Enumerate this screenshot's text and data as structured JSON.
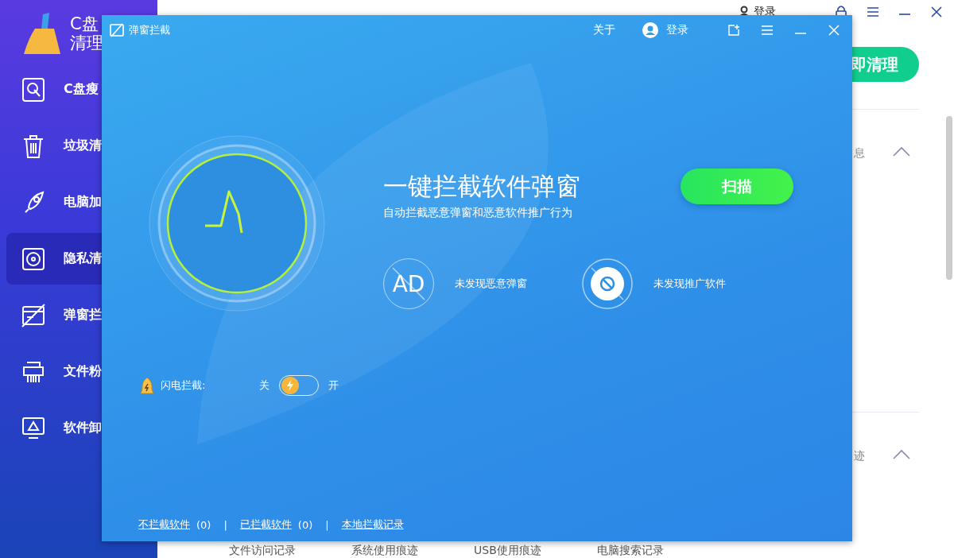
{
  "app": {
    "logo_lines": [
      "C盘",
      "清理"
    ],
    "sidebar": {
      "items": [
        {
          "kind": "disk",
          "label": "C盘瘦",
          "selected": false
        },
        {
          "kind": "trash",
          "label": "垃圾清",
          "selected": false
        },
        {
          "kind": "rocket",
          "label": "电脑加",
          "selected": false
        },
        {
          "kind": "privacy",
          "label": "隐私清",
          "selected": true
        },
        {
          "kind": "popup",
          "label": "弹窗拦",
          "selected": false
        },
        {
          "kind": "shredder",
          "label": "文件粉",
          "selected": false
        },
        {
          "kind": "uninstall",
          "label": "软件卸",
          "selected": false
        }
      ]
    },
    "header": {
      "login": "登录"
    },
    "clean_button": "即清理",
    "sections": [
      {
        "label": "息",
        "expanded": true
      },
      {
        "label": "迹",
        "expanded": true
      }
    ],
    "bottom_tabs": [
      "文件访问记录",
      "系统使用痕迹",
      "USB使用痕迹",
      "电脑搜索记录"
    ]
  },
  "popup": {
    "title": "弹窗拦截",
    "about": "关于",
    "login": "登录",
    "headline": "一键拦截软件弹窗",
    "subtitle": "自动拦截恶意弹窗和恶意软件推广行为",
    "scan_button": "扫描",
    "status": [
      {
        "kind": "ad",
        "icon_text": "AD",
        "label": "未发现恶意弹窗"
      },
      {
        "kind": "promo",
        "label": "未发现推广软件"
      }
    ],
    "flash": {
      "label": "闪电拦截:",
      "off_label": "关",
      "on_label": "开",
      "on": false
    },
    "links": [
      {
        "label": "不拦截软件",
        "count": "(0)"
      },
      {
        "separator": "|",
        "label": "已拦截软件",
        "count": "(0)"
      },
      {
        "separator": "|",
        "label": "本地拦截记录"
      }
    ]
  }
}
